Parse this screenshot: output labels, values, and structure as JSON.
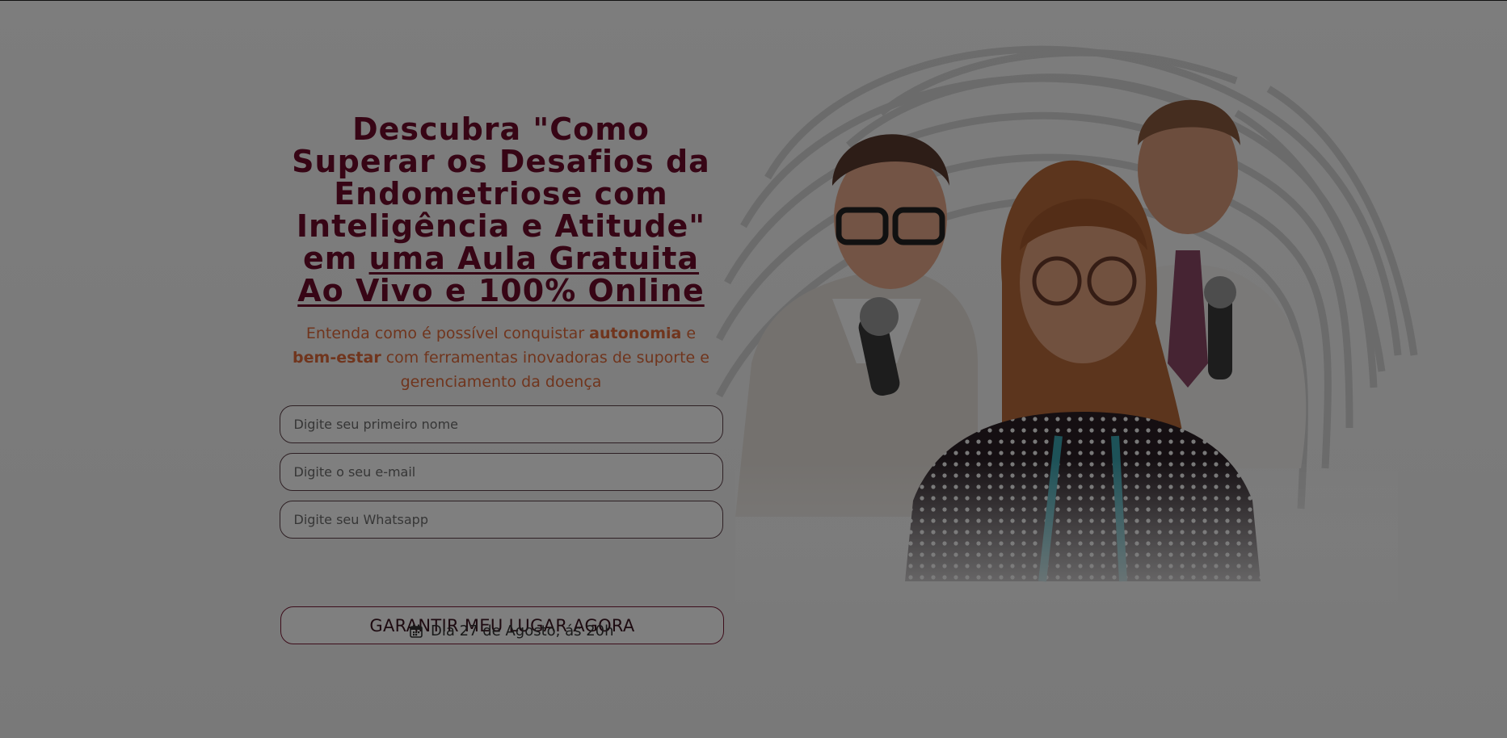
{
  "hero": {
    "headline_line1": "Descubra \"Como",
    "headline_line2": "Superar os Desafios da",
    "headline_line3": "Endometriose com",
    "headline_line4": "Inteligência e Atitude\"",
    "headline_em": "em ",
    "headline_underlined_1": "uma Aula Gratuita",
    "headline_underlined_2": "Ao Vivo e 100% Online",
    "sub_part1": "Entenda como é possível conquistar ",
    "sub_bold1": "autonomia",
    "sub_part2": " e",
    "sub_bold2": "bem-estar",
    "sub_part3": " com ferramentas inovadoras de suporte e",
    "sub_part4": "gerenciamento da doença"
  },
  "form": {
    "name_placeholder": "Digite seu primeiro nome",
    "email_placeholder": "Digite o seu e-mail",
    "whatsapp_placeholder": "Digite seu Whatsapp",
    "cta_label": "GARANTIR MEU LUGAR AGORA"
  },
  "event": {
    "date_text": "Dia 27 de Agosto, ás 20h"
  },
  "icons": {
    "calendar": "calendar-icon"
  },
  "colors": {
    "headline": "#6e0a2a",
    "accent": "#e06a3b",
    "overlay": "rgba(0,0,0,0.5)"
  }
}
